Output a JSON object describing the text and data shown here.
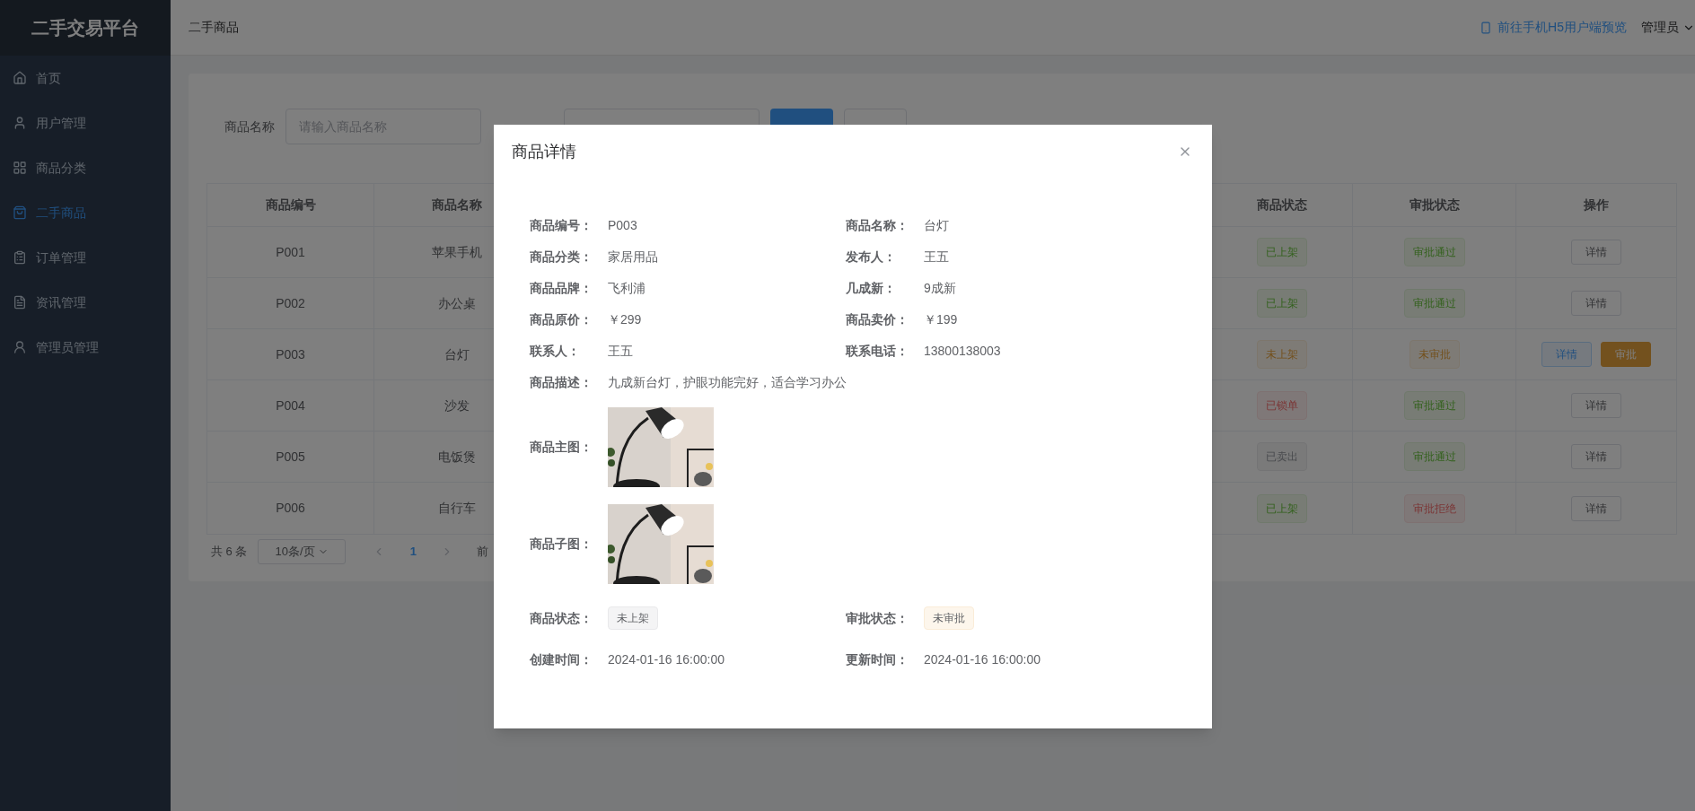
{
  "sidebar": {
    "title": "二手交易平台",
    "items": [
      {
        "label": "首页",
        "selected": false
      },
      {
        "label": "用户管理",
        "selected": false
      },
      {
        "label": "商品分类",
        "selected": false
      },
      {
        "label": "二手商品",
        "selected": true
      },
      {
        "label": "订单管理",
        "selected": false
      },
      {
        "label": "资讯管理",
        "selected": false
      },
      {
        "label": "管理员管理",
        "selected": false
      }
    ]
  },
  "header": {
    "breadcrumb": "二手商品",
    "preview_link": "前往手机H5用户端预览",
    "user": "管理员"
  },
  "filter": {
    "label": "商品名称",
    "placeholder": "请输入商品名称"
  },
  "table": {
    "columns": [
      "商品编号",
      "商品名称",
      "商品状态",
      "审批状态",
      "操作"
    ],
    "rows": [
      {
        "id": "P001",
        "name": "苹果手机",
        "status": {
          "text": "已上架",
          "kind": "success"
        },
        "approval": {
          "text": "审批通过",
          "kind": "success"
        },
        "actions": [
          {
            "label": "详情",
            "kind": "default"
          }
        ]
      },
      {
        "id": "P002",
        "name": "办公桌",
        "status": {
          "text": "已上架",
          "kind": "success"
        },
        "approval": {
          "text": "审批通过",
          "kind": "success"
        },
        "actions": [
          {
            "label": "详情",
            "kind": "default"
          }
        ]
      },
      {
        "id": "P003",
        "name": "台灯",
        "status": {
          "text": "未上架",
          "kind": "warning"
        },
        "approval": {
          "text": "未审批",
          "kind": "warning"
        },
        "actions": [
          {
            "label": "详情",
            "kind": "primary"
          },
          {
            "label": "审批",
            "kind": "warning"
          }
        ]
      },
      {
        "id": "P004",
        "name": "沙发",
        "status": {
          "text": "已锁单",
          "kind": "danger"
        },
        "approval": {
          "text": "审批通过",
          "kind": "success"
        },
        "actions": [
          {
            "label": "详情",
            "kind": "default"
          }
        ]
      },
      {
        "id": "P005",
        "name": "电饭煲",
        "status": {
          "text": "已卖出",
          "kind": "info"
        },
        "approval": {
          "text": "审批通过",
          "kind": "success"
        },
        "actions": [
          {
            "label": "详情",
            "kind": "default"
          }
        ]
      },
      {
        "id": "P006",
        "name": "自行车",
        "status": {
          "text": "已上架",
          "kind": "success"
        },
        "approval": {
          "text": "审批拒绝",
          "kind": "danger"
        },
        "actions": [
          {
            "label": "详情",
            "kind": "default"
          }
        ]
      }
    ]
  },
  "pagination": {
    "total": "共 6 条",
    "page_size": "10条/页",
    "pages": [
      {
        "label": "1",
        "selected": true
      }
    ],
    "jumper": "前"
  },
  "dialog": {
    "title": "商品详情",
    "rows": [
      [
        {
          "label": "商品编号：",
          "kind": "text",
          "value": "P003"
        },
        {
          "label": "商品名称：",
          "kind": "text",
          "value": "台灯"
        }
      ],
      [
        {
          "label": "商品分类：",
          "kind": "text",
          "value": "家居用品"
        },
        {
          "label": "发布人：",
          "kind": "text",
          "value": "王五"
        }
      ],
      [
        {
          "label": "商品品牌：",
          "kind": "text",
          "value": "飞利浦"
        },
        {
          "label": "几成新：",
          "kind": "text",
          "value": "9成新"
        }
      ],
      [
        {
          "label": "商品原价：",
          "kind": "text",
          "value": "￥299"
        },
        {
          "label": "商品卖价：",
          "kind": "text",
          "value": "￥199"
        }
      ],
      [
        {
          "label": "联系人：",
          "kind": "text",
          "value": "王五"
        },
        {
          "label": "联系电话：",
          "kind": "text",
          "value": "13800138003"
        }
      ],
      [
        {
          "label": "商品描述：",
          "kind": "text",
          "value": "九成新台灯，护眼功能完好，适合学习办公"
        }
      ],
      [
        {
          "label": "商品主图："
        }
      ],
      [
        {
          "label": "商品子图："
        }
      ],
      [
        {
          "label": "商品状态：",
          "kind": "tag",
          "tag": {
            "text": "未上架",
            "kind": "info"
          }
        },
        {
          "label": "审批状态：",
          "kind": "tag",
          "tag": {
            "text": "未审批",
            "kind": "warning"
          }
        }
      ],
      [
        {
          "label": "创建时间：",
          "kind": "text",
          "value": "2024-01-16 16:00:00"
        },
        {
          "label": "更新时间：",
          "kind": "text",
          "value": "2024-01-16 16:00:00"
        }
      ]
    ]
  }
}
